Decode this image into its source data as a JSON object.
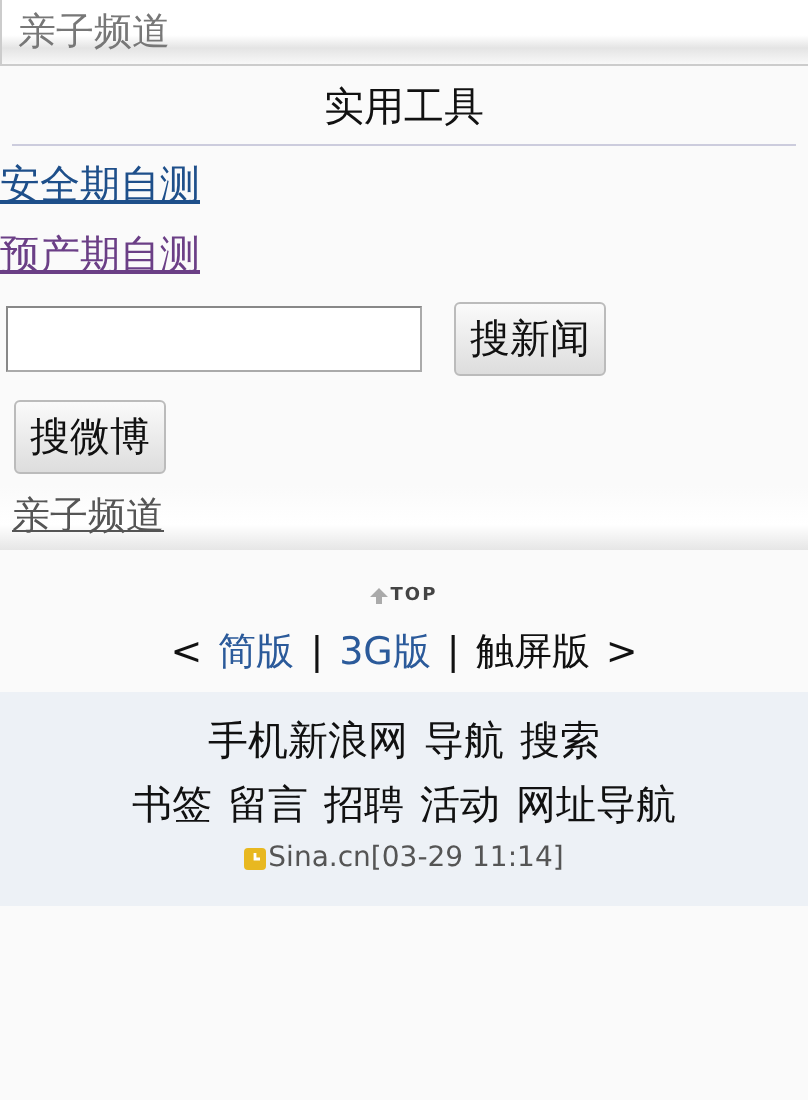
{
  "header": {
    "title": "亲子频道"
  },
  "section": {
    "title": "实用工具"
  },
  "links": [
    {
      "label": "安全期自测",
      "visited": false
    },
    {
      "label": "预产期自测",
      "visited": true
    }
  ],
  "search": {
    "buttons": [
      "搜新闻",
      "搜微博"
    ]
  },
  "channel_link": "亲子频道",
  "top_link": "TOP",
  "versions": {
    "open": "<",
    "close": ">",
    "separator": "|",
    "items": [
      {
        "label": "简版",
        "selected": false
      },
      {
        "label": "3G版",
        "selected": false
      },
      {
        "label": "触屏版",
        "selected": true
      }
    ]
  },
  "footer": {
    "nav_lines": [
      {
        "links": [
          "手机新浪网",
          "导航",
          "搜索"
        ]
      },
      {
        "links": [
          "书签",
          "留言",
          "招聘",
          "活动",
          "网址导航"
        ]
      }
    ],
    "stamp": "Sina.cn[03-29 11:14]"
  }
}
